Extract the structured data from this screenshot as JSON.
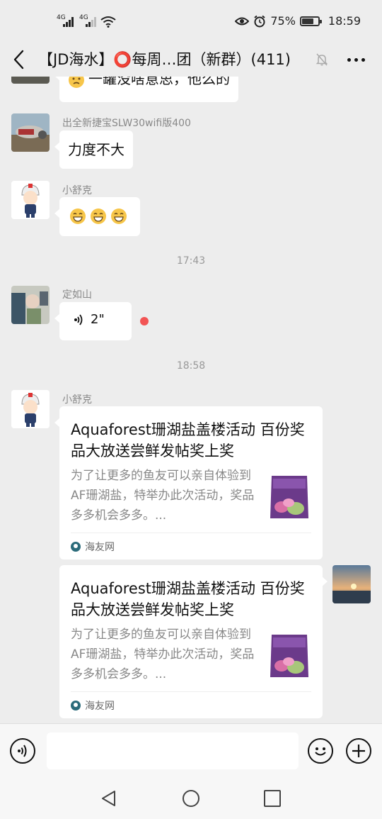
{
  "status_bar": {
    "signal_1": "4G",
    "signal_2": "4G",
    "battery_text": "75%",
    "battery_level": 0.75,
    "time": "18:59"
  },
  "nav": {
    "title": "【JD海水】⭕每周…团（新群）(411)"
  },
  "messages": {
    "partial_text": "一罐没啥意思，他么的",
    "m1": {
      "sender": "出全新捷宝SLW30wifi版400",
      "text": "力度不大"
    },
    "m2": {
      "sender": "小舒克",
      "emojis": [
        "grin",
        "grin",
        "grin"
      ]
    },
    "time_1": "17:43",
    "m3": {
      "sender": "定如山",
      "voice_duration": "2\""
    },
    "time_2": "18:58",
    "m4": {
      "sender": "小舒克",
      "card_title": "Aquaforest珊湖盐盖楼活动 百份奖品大放送尝鲜发帖奖上奖",
      "card_desc": "为了让更多的鱼友可以亲自体验到AF珊湖盐，特举办此次活动，奖品多多机会多多。...",
      "card_source": "海友网"
    },
    "m5": {
      "card_title": "Aquaforest珊湖盐盖楼活动 百份奖品大放送尝鲜发帖奖上奖",
      "card_desc": "为了让更多的鱼友可以亲自体验到AF珊湖盐，特举办此次活动，奖品多多机会多多。...",
      "card_source": "海友网"
    }
  },
  "input": {
    "placeholder": ""
  },
  "colors": {
    "background": "#ededed",
    "bubble": "#ffffff",
    "unread_dot": "#f25454",
    "secondary_text": "#888888"
  }
}
